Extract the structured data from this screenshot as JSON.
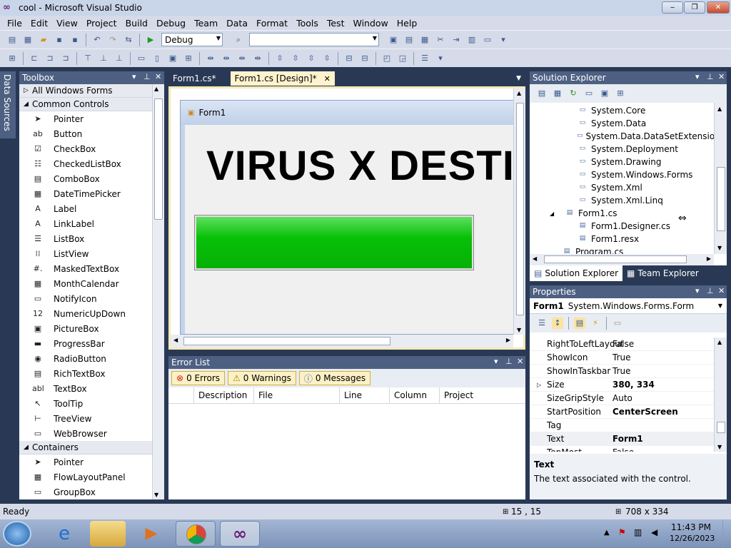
{
  "window": {
    "title": "cool - Microsoft Visual Studio",
    "min": "‒",
    "max": "❐",
    "close": "✕"
  },
  "menu": [
    "File",
    "Edit",
    "View",
    "Project",
    "Build",
    "Debug",
    "Team",
    "Data",
    "Format",
    "Tools",
    "Test",
    "Window",
    "Help"
  ],
  "toolbar": {
    "config": "Debug",
    "platform": ""
  },
  "toolbox": {
    "title": "Toolbox",
    "sidebar_label": "Data Sources",
    "all_forms": "All Windows Forms",
    "common": "Common Controls",
    "common_items": [
      {
        "label": "Pointer",
        "icon": "pointer-icon",
        "glyph": "➤"
      },
      {
        "label": "Button",
        "icon": "button-icon",
        "glyph": "ab"
      },
      {
        "label": "CheckBox",
        "icon": "checkbox-icon",
        "glyph": "☑"
      },
      {
        "label": "CheckedListBox",
        "icon": "checkedlistbox-icon",
        "glyph": "☷"
      },
      {
        "label": "ComboBox",
        "icon": "combobox-icon",
        "glyph": "▤"
      },
      {
        "label": "DateTimePicker",
        "icon": "datetimepicker-icon",
        "glyph": "▦"
      },
      {
        "label": "Label",
        "icon": "label-icon",
        "glyph": "A"
      },
      {
        "label": "LinkLabel",
        "icon": "linklabel-icon",
        "glyph": "A"
      },
      {
        "label": "ListBox",
        "icon": "listbox-icon",
        "glyph": "☰"
      },
      {
        "label": "ListView",
        "icon": "listview-icon",
        "glyph": "⁞⁞"
      },
      {
        "label": "MaskedTextBox",
        "icon": "maskedtextbox-icon",
        "glyph": "#."
      },
      {
        "label": "MonthCalendar",
        "icon": "monthcalendar-icon",
        "glyph": "▦"
      },
      {
        "label": "NotifyIcon",
        "icon": "notifyicon-icon",
        "glyph": "▭"
      },
      {
        "label": "NumericUpDown",
        "icon": "numericupdown-icon",
        "glyph": "12"
      },
      {
        "label": "PictureBox",
        "icon": "picturebox-icon",
        "glyph": "▣"
      },
      {
        "label": "ProgressBar",
        "icon": "progressbar-icon",
        "glyph": "▬"
      },
      {
        "label": "RadioButton",
        "icon": "radiobutton-icon",
        "glyph": "◉"
      },
      {
        "label": "RichTextBox",
        "icon": "richtextbox-icon",
        "glyph": "▤"
      },
      {
        "label": "TextBox",
        "icon": "textbox-icon",
        "glyph": "abl"
      },
      {
        "label": "ToolTip",
        "icon": "tooltip-icon",
        "glyph": "↖"
      },
      {
        "label": "TreeView",
        "icon": "treeview-icon",
        "glyph": "⊢"
      },
      {
        "label": "WebBrowser",
        "icon": "webbrowser-icon",
        "glyph": "▭"
      }
    ],
    "containers": "Containers",
    "container_items": [
      {
        "label": "Pointer",
        "icon": "pointer-icon",
        "glyph": "➤"
      },
      {
        "label": "FlowLayoutPanel",
        "icon": "flowlayoutpanel-icon",
        "glyph": "▦"
      },
      {
        "label": "GroupBox",
        "icon": "groupbox-icon",
        "glyph": "▭"
      }
    ]
  },
  "tabs": [
    {
      "label": "Form1.cs*"
    },
    {
      "label": "Form1.cs [Design]*"
    }
  ],
  "designer": {
    "form_title": "Form1",
    "heading": "VIRUS X DESTI"
  },
  "errorlist": {
    "title": "Error List",
    "errors": "0 Errors",
    "warnings": "0 Warnings",
    "messages": "0 Messages",
    "columns": [
      "Description",
      "File",
      "Line",
      "Column",
      "Project"
    ]
  },
  "solution": {
    "title": "Solution Explorer",
    "items": [
      {
        "label": "System.Core",
        "level": 2
      },
      {
        "label": "System.Data",
        "level": 2
      },
      {
        "label": "System.Data.DataSetExtensions",
        "level": 2
      },
      {
        "label": "System.Deployment",
        "level": 2
      },
      {
        "label": "System.Drawing",
        "level": 2
      },
      {
        "label": "System.Windows.Forms",
        "level": 2
      },
      {
        "label": "System.Xml",
        "level": 2
      },
      {
        "label": "System.Xml.Linq",
        "level": 2
      },
      {
        "label": "Form1.cs",
        "level": 1
      },
      {
        "label": "Form1.Designer.cs",
        "level": 2
      },
      {
        "label": "Form1.resx",
        "level": 2
      },
      {
        "label": "Program.cs",
        "level": 1
      }
    ],
    "tab1": "Solution Explorer",
    "tab2": "Team Explorer"
  },
  "properties": {
    "title": "Properties",
    "object": "Form1",
    "type": "System.Windows.Forms.Form",
    "rows": [
      {
        "name": "RightToLeftLayout",
        "value": "False"
      },
      {
        "name": "ShowIcon",
        "value": "True"
      },
      {
        "name": "ShowInTaskbar",
        "value": "True"
      },
      {
        "name": "Size",
        "value": "380, 334"
      },
      {
        "name": "SizeGripStyle",
        "value": "Auto"
      },
      {
        "name": "StartPosition",
        "value": "CenterScreen"
      },
      {
        "name": "Tag",
        "value": ""
      },
      {
        "name": "Text",
        "value": "Form1"
      },
      {
        "name": "TopMost",
        "value": "False"
      }
    ],
    "desc_title": "Text",
    "desc_text": "The text associated with the control."
  },
  "status": {
    "left": "Ready",
    "position": "15 , 15",
    "size": "708 x 334"
  },
  "clock": {
    "time": "11:43 PM",
    "date": "12/26/2023"
  }
}
